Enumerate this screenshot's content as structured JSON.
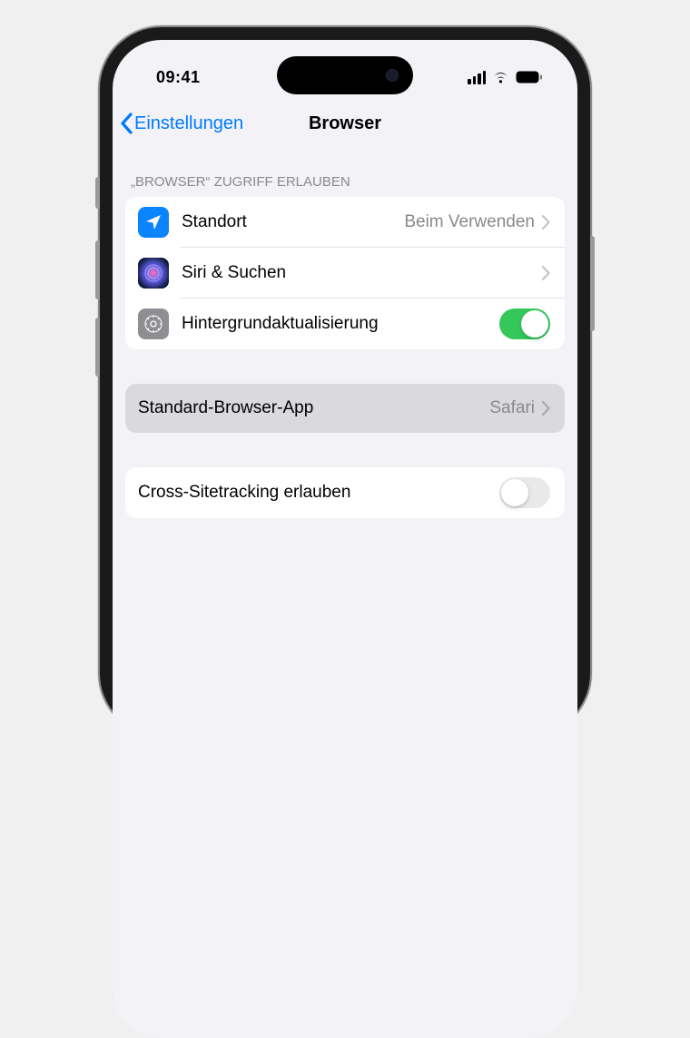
{
  "status": {
    "time": "09:41"
  },
  "nav": {
    "back_label": "Einstellungen",
    "title": "Browser"
  },
  "section1": {
    "header": "„BROWSER“ ZUGRIFF ERLAUBEN",
    "rows": {
      "location": {
        "label": "Standort",
        "value": "Beim Verwenden"
      },
      "siri": {
        "label": "Siri & Suchen"
      },
      "bg_refresh": {
        "label": "Hintergrundaktualisierung",
        "enabled": true
      }
    }
  },
  "section2": {
    "label": "Standard-Browser-App",
    "value": "Safari"
  },
  "section3": {
    "label": "Cross-Sitetracking erlauben",
    "enabled": false
  }
}
